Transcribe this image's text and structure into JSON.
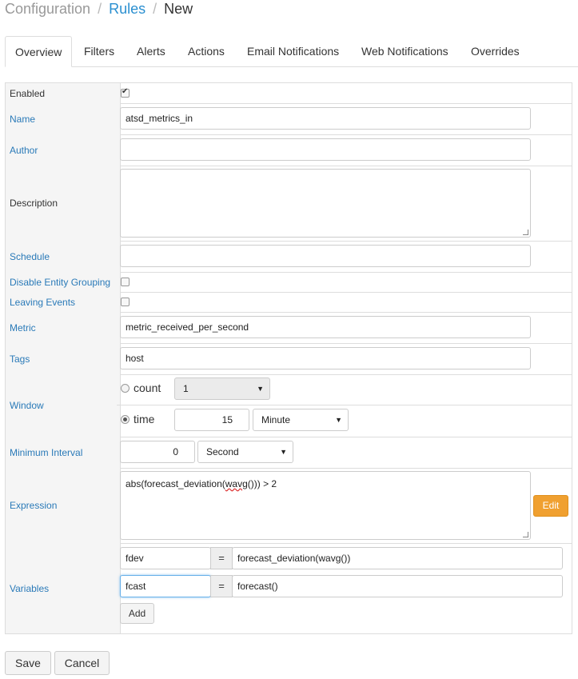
{
  "breadcrumb": {
    "root": "Configuration",
    "section": "Rules",
    "current": "New",
    "separator": "/"
  },
  "tabs": [
    "Overview",
    "Filters",
    "Alerts",
    "Actions",
    "Email Notifications",
    "Web Notifications",
    "Overrides"
  ],
  "active_tab": "Overview",
  "form": {
    "enabled": {
      "label": "Enabled",
      "checked": true
    },
    "name": {
      "label": "Name",
      "value": "atsd_metrics_in"
    },
    "author": {
      "label": "Author",
      "value": ""
    },
    "description": {
      "label": "Description",
      "value": ""
    },
    "schedule": {
      "label": "Schedule",
      "value": ""
    },
    "disable_entity_grouping": {
      "label": "Disable Entity Grouping",
      "checked": false
    },
    "leaving_events": {
      "label": "Leaving Events",
      "checked": false
    },
    "metric": {
      "label": "Metric",
      "value": "metric_received_per_second"
    },
    "tags": {
      "label": "Tags",
      "value": "host"
    },
    "window": {
      "label": "Window",
      "count_label": "count",
      "count_value": "1",
      "time_label": "time",
      "time_value": "15",
      "time_unit": "Minute",
      "selected": "time"
    },
    "minimum_interval": {
      "label": "Minimum Interval",
      "value": "0",
      "unit": "Second"
    },
    "expression": {
      "label": "Expression",
      "value_prefix": "abs(forecast_deviation(",
      "value_misspelled": "wavg",
      "value_suffix": "())) > 2",
      "edit_label": "Edit"
    },
    "variables": {
      "label": "Variables",
      "items": [
        {
          "name": "fdev",
          "eq": "=",
          "value": "forecast_deviation(wavg())"
        },
        {
          "name": "fcast",
          "eq": "=",
          "value": "forecast()"
        }
      ],
      "add_label": "Add"
    }
  },
  "actions": {
    "save": "Save",
    "cancel": "Cancel"
  }
}
